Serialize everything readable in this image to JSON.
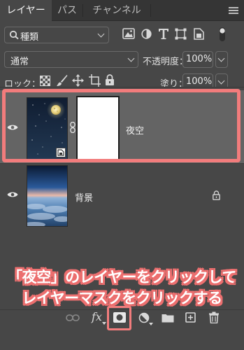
{
  "tabs": [
    {
      "label": "レイヤー",
      "active": true
    },
    {
      "label": "パス",
      "active": false
    },
    {
      "label": "チャンネル",
      "active": false
    }
  ],
  "filter": {
    "kind_label": "種類"
  },
  "blend": {
    "mode": "通常",
    "opacity_label": "不透明度：",
    "opacity_value": "100%"
  },
  "lock": {
    "label": "ロック：",
    "fill_label": "塗り：",
    "fill_value": "100%"
  },
  "layers": [
    {
      "name": "夜空",
      "selected": true,
      "has_mask": true
    },
    {
      "name": "背景",
      "selected": false,
      "locked": true
    }
  ],
  "annotation": {
    "line1": "「夜空」のレイヤーをクリックして",
    "line2": "レイヤーマスクをクリックする"
  },
  "bottom": {
    "fx_label": "fx"
  },
  "colors": {
    "highlight": "#f27c7c",
    "panel": "#474747",
    "selected_row": "#646464"
  }
}
